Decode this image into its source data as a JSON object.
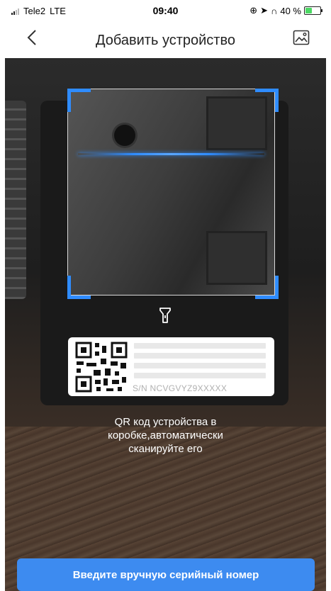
{
  "status_bar": {
    "carrier": "Tele2",
    "network": "LTE",
    "time": "09:40",
    "battery_percent": "40 %",
    "battery_level": 0.4,
    "icons": [
      "signal-icon",
      "location-icon",
      "headphones-icon",
      "rotation-lock-icon",
      "battery-charging-icon"
    ]
  },
  "header": {
    "title": "Добавить устройство",
    "back_icon": "chevron-left-icon",
    "gallery_icon": "image-gallery-icon"
  },
  "scanner": {
    "torch_icon": "flashlight-icon",
    "accent_color": "#2f8cff"
  },
  "sample_label": {
    "serial": "S/N  NCVGVYZ9XXXXX"
  },
  "hint": {
    "lines": [
      "QR код устройства в",
      "коробке,автоматически",
      "сканируйте его"
    ]
  },
  "manual_button": {
    "label": "Введите вручную серийный номер",
    "color": "#3d8bf0"
  }
}
